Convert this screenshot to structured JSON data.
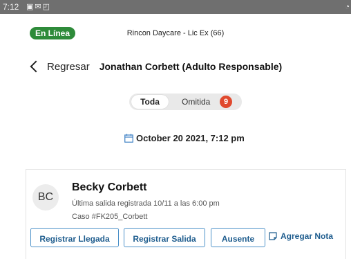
{
  "status_bar": {
    "time": "7:12",
    "icons": [
      "image-icon",
      "mail-icon",
      "screenshot-icon"
    ]
  },
  "header": {
    "status_badge": "En Línea",
    "center_title": "Rincon Daycare - Lic Ex (66)"
  },
  "nav": {
    "back_label": "Regresar",
    "page_title": "Jonathan Corbett (Adulto Responsable)"
  },
  "filters": {
    "all_label": "Toda",
    "omitted_label": "Omitida",
    "omitted_count": "9"
  },
  "date": {
    "text": "October 20 2021, 7:12 pm"
  },
  "child": {
    "initials": "BC",
    "name": "Becky Corbett",
    "last_out": "Última salida registrada 10/11 a las 6:00 pm",
    "case": "Caso #FK205_Corbett"
  },
  "actions": {
    "check_in": "Registrar Llegada",
    "check_out": "Registrar Salida",
    "absent": "Ausente",
    "add_note": "Agregar Nota"
  },
  "colors": {
    "online": "#2e8b3a",
    "badge": "#e0492e",
    "accent": "#1f5d8e",
    "button_border": "#4a90c8"
  }
}
